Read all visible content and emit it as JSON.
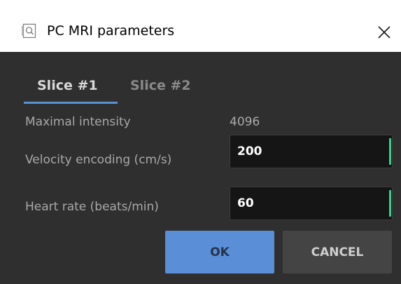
{
  "window": {
    "title": "PC MRI parameters",
    "close_symbol": "✕",
    "app_icon": "search-document-icon"
  },
  "tabs": [
    {
      "label": "Slice #1",
      "active": true
    },
    {
      "label": "Slice #2",
      "active": false
    }
  ],
  "fields": {
    "max_intensity": {
      "label": "Maximal intensity",
      "value": "4096"
    },
    "velocity_encoding": {
      "label": "Velocity encoding (cm/s)",
      "value": "200"
    },
    "heart_rate": {
      "label": "Heart rate (beats/min)",
      "value": "60"
    }
  },
  "buttons": {
    "ok": "OK",
    "cancel": "CANCEL"
  },
  "colors": {
    "accent": "#5a8fd8",
    "input_indicator": "#3ccf8e",
    "background": "#2f2f2f"
  }
}
